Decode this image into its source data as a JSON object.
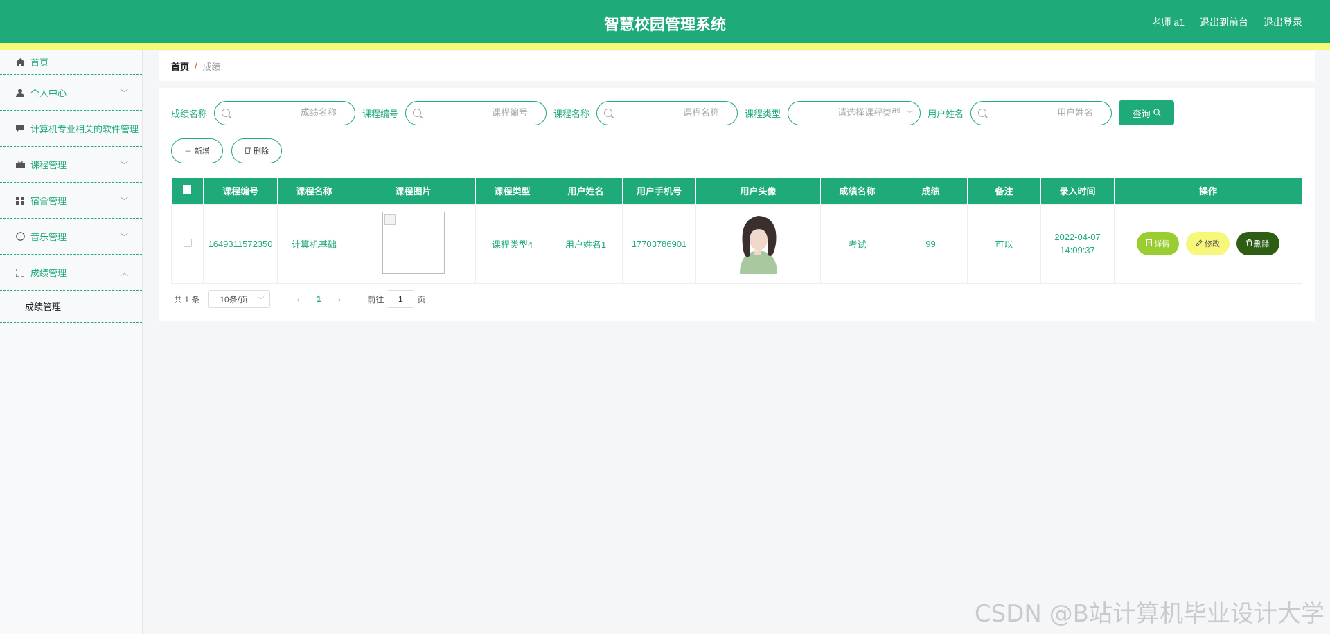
{
  "header": {
    "title": "智慧校园管理系统",
    "user_label": "老师 a1",
    "to_front_label": "退出到前台",
    "logout_label": "退出登录",
    "color": "#1fab79",
    "stripe_color": "#f7f77a"
  },
  "sidebar": {
    "items": [
      {
        "label": "首页",
        "icon": "home-icon"
      },
      {
        "label": "个人中心",
        "icon": "user-icon"
      },
      {
        "label": "计算机专业相关的软件管理",
        "icon": "chat-icon"
      },
      {
        "label": "课程管理",
        "icon": "briefcase-icon"
      },
      {
        "label": "宿舍管理",
        "icon": "grid-icon"
      },
      {
        "label": "音乐管理",
        "icon": "compass-icon"
      },
      {
        "label": "成绩管理",
        "icon": "fullscreen-icon"
      }
    ],
    "sub_item": "成绩管理"
  },
  "breadcrumb": {
    "home": "首页",
    "separator": "/",
    "current": "成绩"
  },
  "filters": {
    "score_name_label": "成绩名称",
    "score_name_placeholder": "成绩名称",
    "course_code_label": "课程编号",
    "course_code_placeholder": "课程编号",
    "course_name_label": "课程名称",
    "course_name_placeholder": "课程名称",
    "course_type_label": "课程类型",
    "course_type_placeholder": "请选择课程类型",
    "user_name_label": "用户姓名",
    "user_name_placeholder": "用户姓名",
    "query_label": "查询"
  },
  "actions": {
    "add_label": "新增",
    "delete_label": "删除"
  },
  "table": {
    "headers": [
      "课程编号",
      "课程名称",
      "课程图片",
      "课程类型",
      "用户姓名",
      "用户手机号",
      "用户头像",
      "成绩名称",
      "成绩",
      "备注",
      "录入时间",
      "操作"
    ],
    "rows": [
      {
        "course_code": "1649311572350",
        "course_name": "计算机基础",
        "course_type": "课程类型4",
        "user_name": "用户姓名1",
        "phone": "17703786901",
        "score_name": "考试",
        "score": "99",
        "remark": "可以",
        "time": "2022-04-07 14:09:37",
        "detail_label": "详情",
        "edit_label": "修改",
        "delete_label": "删除"
      }
    ]
  },
  "pagination": {
    "total": "共 1 条",
    "page_size": "10条/页",
    "current_page": "1",
    "goto_label": "前往",
    "goto_value": "1",
    "page_suffix": "页"
  },
  "watermark": "CSDN @B站计算机毕业设计大学"
}
